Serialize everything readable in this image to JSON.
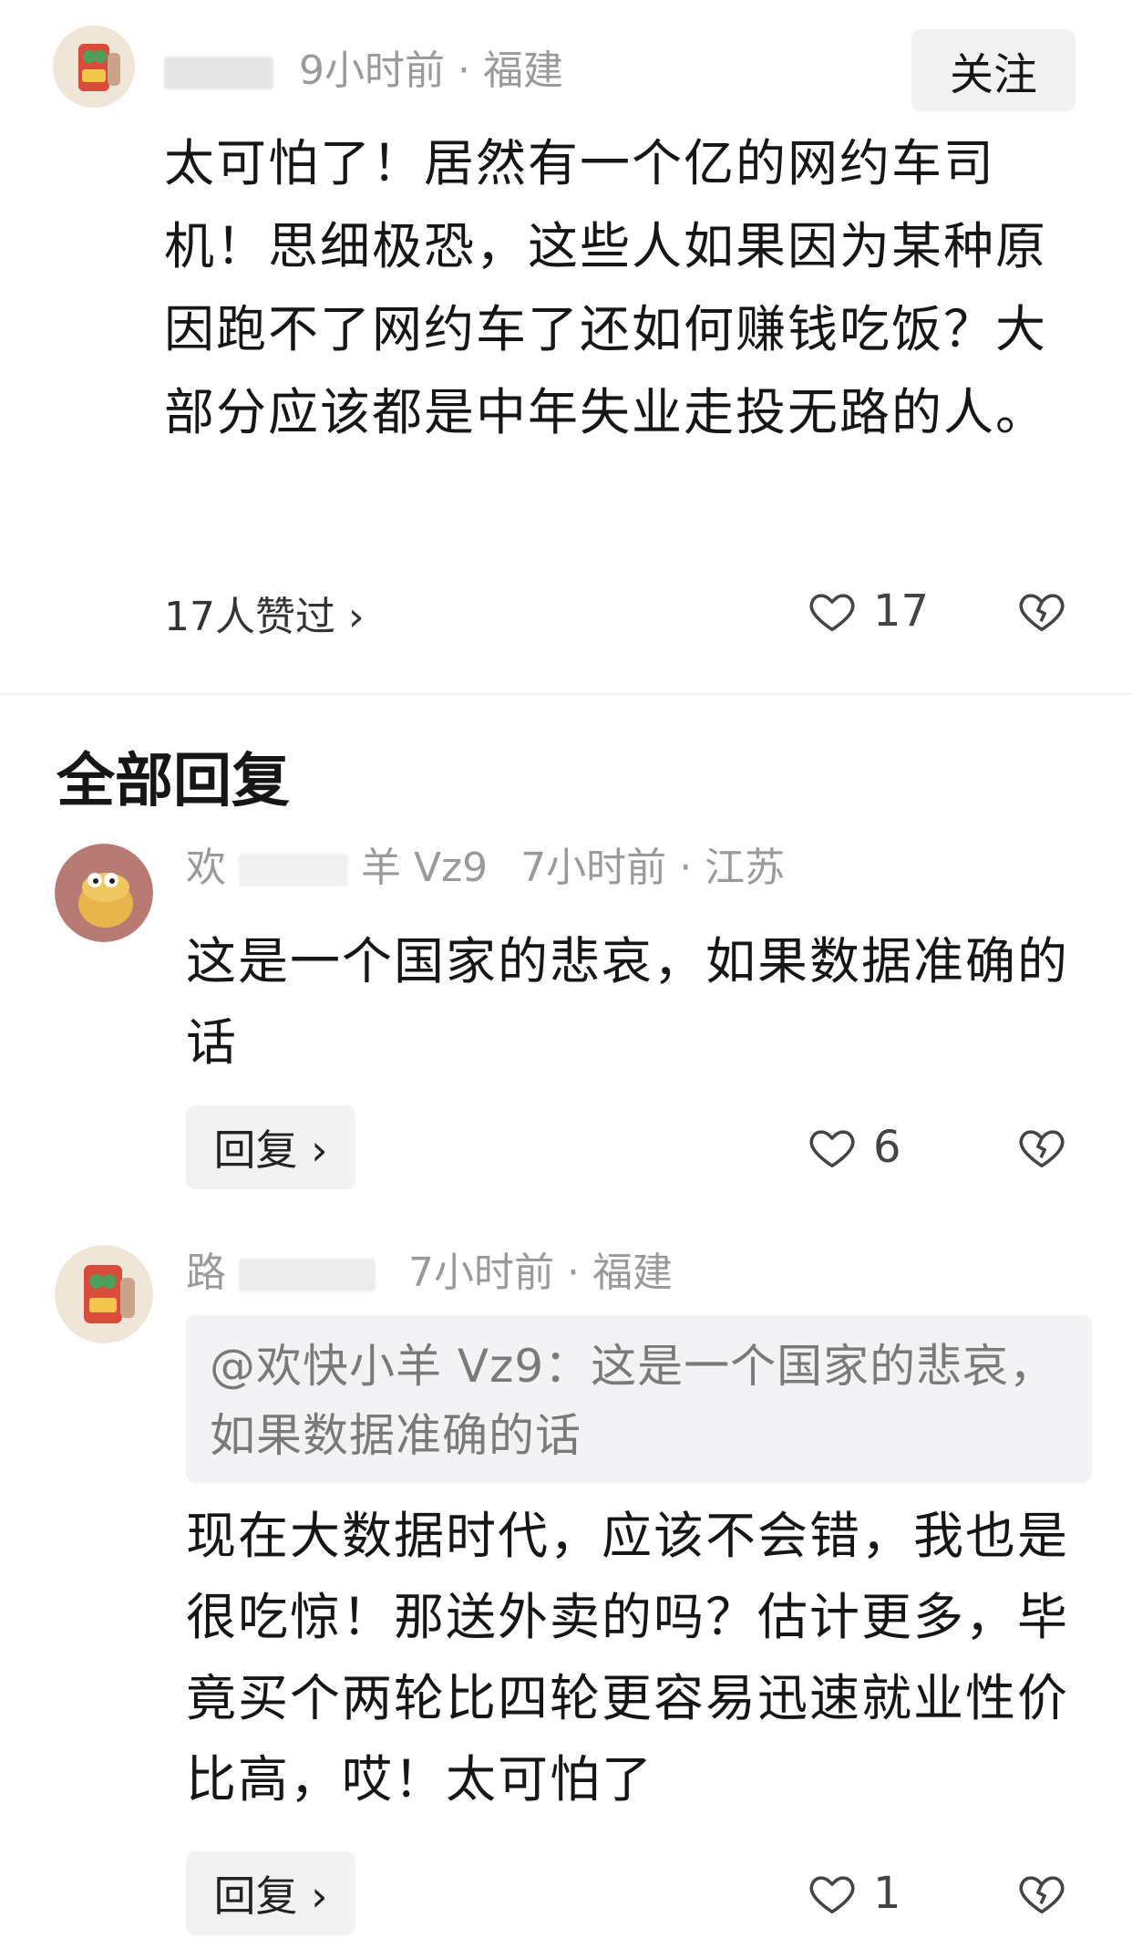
{
  "main_comment": {
    "username": "",
    "time": "9小时前",
    "location": "福建",
    "follow_label": "关注",
    "text": "太可怕了！居然有一个亿的网约车司机！思细极恐，这些人如果因为某种原因跑不了网约车了还如何赚钱吃饭？大部分应该都是中年失业走投无路的人。",
    "likes_summary": "17人赞过 ›",
    "like_count": "17"
  },
  "section_title": "全部回复",
  "replies": [
    {
      "username_start": "欢",
      "username_end": "羊 Vz9",
      "time": "7小时前",
      "location": "江苏",
      "text": "这是一个国家的悲哀，如果数据准确的话",
      "reply_label": "回复 ›",
      "like_count": "6"
    },
    {
      "username_start": "路",
      "time": "7小时前",
      "location": "福建",
      "quote": "@欢快小羊 Vz9：这是一个国家的悲哀，如果数据准确的话",
      "text": "现在大数据时代，应该不会错，我也是很吃惊！那送外卖的吗？估计更多，毕竟买个两轮比四轮更容易迅速就业性价比高，哎！太可怕了",
      "reply_label": "回复 ›",
      "like_count": "1"
    }
  ],
  "colors": {
    "text": "#161616",
    "meta": "#9a9a9a",
    "button_bg": "#f2f2f2",
    "quote_bg": "#f3f3f5"
  }
}
